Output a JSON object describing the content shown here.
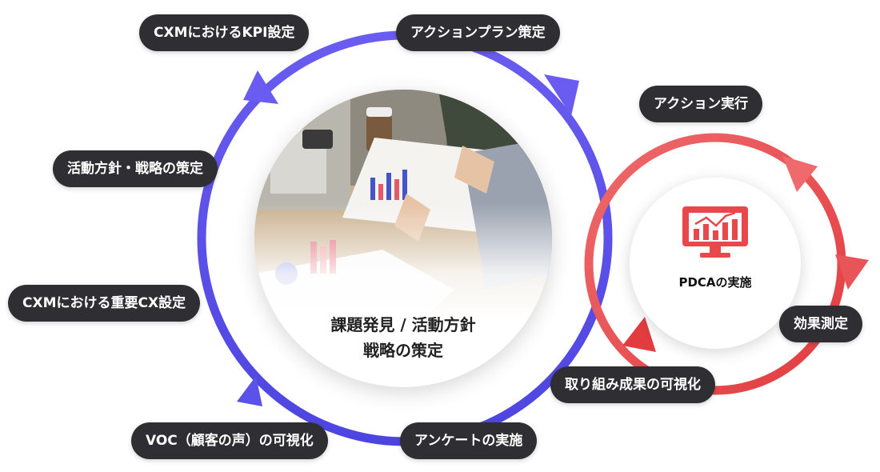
{
  "main_cycle": {
    "center_lines": [
      "課題発見 / 活動方針",
      "戦略の策定"
    ],
    "steps": [
      "CXMにおけるKPI設定",
      "アクションプラン策定",
      "活動方針・戦略の策定",
      "CXMにおける重要CX設定",
      "VOC（顧客の声）の可視化",
      "アンケートの実施"
    ],
    "color": "#5a50e6"
  },
  "pdca_cycle": {
    "label": "PDCAの実施",
    "icon": "analytics-monitor-icon",
    "steps": [
      "アクション実行",
      "効果測定",
      "取り組み成果の可視化"
    ],
    "color": "#e8484b"
  },
  "pill_color": "#2f2f33"
}
